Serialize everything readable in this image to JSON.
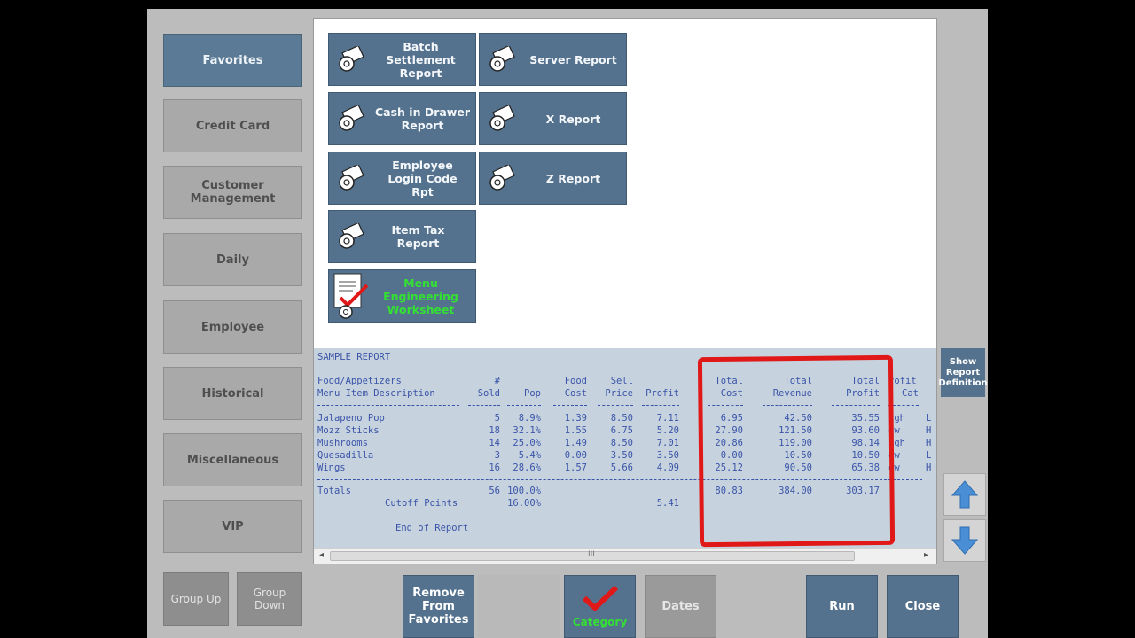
{
  "categories": [
    {
      "label": "Favorites",
      "active": true
    },
    {
      "label": "Credit Card",
      "active": false
    },
    {
      "label": "Customer Management",
      "active": false
    },
    {
      "label": "Daily",
      "active": false
    },
    {
      "label": "Employee",
      "active": false
    },
    {
      "label": "Historical",
      "active": false
    },
    {
      "label": "Miscellaneous",
      "active": false
    },
    {
      "label": "VIP",
      "active": false
    }
  ],
  "reports": [
    {
      "label": "Batch Settlement Report"
    },
    {
      "label": "Server Report"
    },
    {
      "label": "Cash in Drawer Report"
    },
    {
      "label": "X Report"
    },
    {
      "label": "Employee Login Code Rpt"
    },
    {
      "label": "Z Report"
    },
    {
      "label": "Item Tax Report"
    },
    {
      "label": "Menu Engineering Worksheet",
      "selected": true
    }
  ],
  "preview": {
    "title": "SAMPLE REPORT",
    "section": "Food/Appetizers",
    "desc_header": "Menu Item Description",
    "col_headers_top": [
      "#",
      "",
      "Food",
      "Sell",
      "",
      "Total",
      "Total",
      "Total",
      "rofit"
    ],
    "col_headers_bottom": [
      "Sold",
      "Pop",
      "Cost",
      "Price",
      "Profit",
      "Cost",
      "Revenue",
      "Profit",
      "Cat"
    ],
    "rows": [
      {
        "name": "Jalapeno Pop",
        "sold": "5",
        "pop": "8.9%",
        "food_cost": "1.39",
        "sell_price": "8.50",
        "profit": "7.11",
        "total_cost": "6.95",
        "total_revenue": "42.50",
        "total_profit": "35.55",
        "cat": "igh",
        "extra": "L"
      },
      {
        "name": "Mozz Sticks",
        "sold": "18",
        "pop": "32.1%",
        "food_cost": "1.55",
        "sell_price": "6.75",
        "profit": "5.20",
        "total_cost": "27.90",
        "total_revenue": "121.50",
        "total_profit": "93.60",
        "cat": "ow",
        "extra": "H"
      },
      {
        "name": "Mushrooms",
        "sold": "14",
        "pop": "25.0%",
        "food_cost": "1.49",
        "sell_price": "8.50",
        "profit": "7.01",
        "total_cost": "20.86",
        "total_revenue": "119.00",
        "total_profit": "98.14",
        "cat": "igh",
        "extra": "H"
      },
      {
        "name": "Quesadilla",
        "sold": "3",
        "pop": "5.4%",
        "food_cost": "0.00",
        "sell_price": "3.50",
        "profit": "3.50",
        "total_cost": "0.00",
        "total_revenue": "10.50",
        "total_profit": "10.50",
        "cat": "ow",
        "extra": "L"
      },
      {
        "name": "Wings",
        "sold": "16",
        "pop": "28.6%",
        "food_cost": "1.57",
        "sell_price": "5.66",
        "profit": "4.09",
        "total_cost": "25.12",
        "total_revenue": "90.50",
        "total_profit": "65.38",
        "cat": "ow",
        "extra": "H"
      }
    ],
    "totals_label": "Totals",
    "totals": {
      "sold": "56",
      "pop": "100.0%",
      "total_cost": "80.83",
      "total_revenue": "384.00",
      "total_profit": "303.17"
    },
    "cutoff_label": "Cutoff Points",
    "cutoff": {
      "pop": "16.00%",
      "profit": "5.41"
    },
    "end_label": "End of Report",
    "scroll_grip": "III"
  },
  "show_definition": "Show Report Definition",
  "bottom": {
    "group_up": "Group Up",
    "group_down": "Group Down",
    "remove_favorites": "Remove From Favorites",
    "category": "Category",
    "dates": "Dates",
    "run": "Run",
    "close": "Close"
  },
  "colors": {
    "accent": "#54728e",
    "highlight": "#e01818",
    "green_text": "#33e033",
    "report_text": "#3b54a8"
  }
}
